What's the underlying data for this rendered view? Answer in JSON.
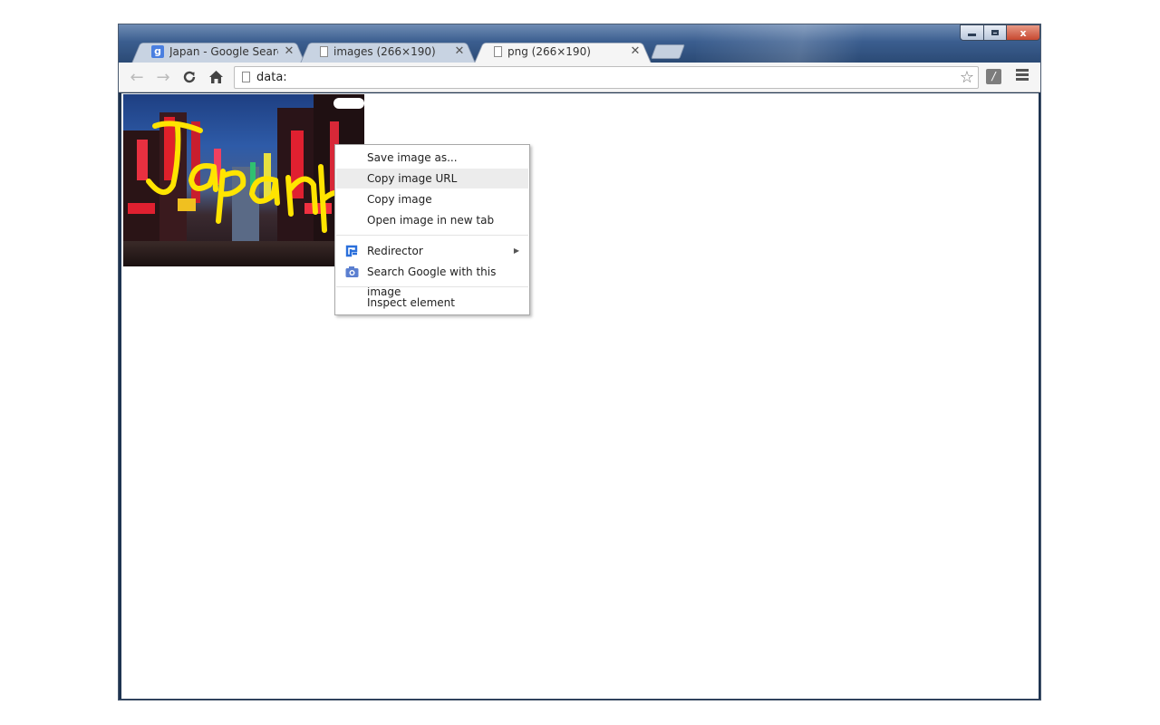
{
  "window": {
    "controls": {
      "minimize": "",
      "maximize": "",
      "close": "x"
    }
  },
  "tabs": [
    {
      "title": "Japan - Google Search",
      "favicon": "google-g-icon",
      "active": false
    },
    {
      "title": "images (266×190)",
      "favicon": "page-icon",
      "active": false
    },
    {
      "title": "png (266×190)",
      "favicon": "page-icon",
      "active": true
    }
  ],
  "toolbar": {
    "back_icon": "←",
    "forward_icon": "→",
    "reload_icon": "C",
    "home_icon": "⌂",
    "address_value": "data:",
    "bookmark_icon": "☆",
    "extension_icon": "/"
  },
  "page": {
    "image_caption": "Japan"
  },
  "context_menu": {
    "items": [
      {
        "label": "Save image as..."
      },
      {
        "label": "Copy image URL"
      },
      {
        "label": "Copy image"
      },
      {
        "label": "Open image in new tab"
      },
      {
        "label": "Redirector",
        "submenu": "▶"
      },
      {
        "label": "Search Google with this image"
      },
      {
        "label": "Inspect element"
      }
    ]
  },
  "colors": {
    "titlebar": "#3b5e8f",
    "redirector_icon": "#2a6fdb",
    "camera_icon": "#5b7fd0",
    "caption_yellow": "#ffe400"
  }
}
